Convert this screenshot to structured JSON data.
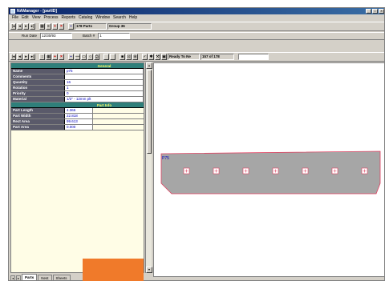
{
  "window": {
    "title": "NAManager - [partID]"
  },
  "menu": [
    "File",
    "Edit",
    "View",
    "Process",
    "Reports",
    "Catalog",
    "Window",
    "Search",
    "Help"
  ],
  "toolbar1": {
    "parts_count": "178 Parts",
    "group": "Group 36"
  },
  "toolbar2": {
    "run_date_label": "Run Date",
    "run_date_value": "12/30/93",
    "batch_label": "Batch #",
    "batch_value": "1"
  },
  "toolbar3": {
    "status": "Ready To Ne",
    "record": "157 of 178"
  },
  "properties": {
    "general_header": "General",
    "general_rows": [
      {
        "name": "Name",
        "value": "p75"
      },
      {
        "name": "Comments",
        "value": ""
      },
      {
        "name": "Quantity",
        "value": "16"
      },
      {
        "name": "Rotation",
        "value": "1"
      },
      {
        "name": "Priority",
        "value": "0"
      },
      {
        "name": "Material",
        "value": "1/2\" - 12mm plt"
      }
    ],
    "partinfo_header": "Part Info",
    "partinfo_rows": [
      {
        "name": "Part Length",
        "value": "4.365"
      },
      {
        "name": "Part Width",
        "value": "22.818"
      },
      {
        "name": "Rect Area",
        "value": "99.613"
      },
      {
        "name": "Part Area",
        "value": "0.000"
      }
    ]
  },
  "canvas": {
    "part_label": "P75"
  },
  "tabs": [
    {
      "label": "Parts"
    },
    {
      "label": "Nest"
    },
    {
      "label": "Sheets"
    }
  ],
  "colors": {
    "section_header_bg": "#2f7f7a",
    "section_header_text": "#ffff66",
    "value_text": "#0000c0",
    "part_fill": "#a6a6a6",
    "hole_color": "#e04060",
    "overlay": "#f07a2a"
  }
}
